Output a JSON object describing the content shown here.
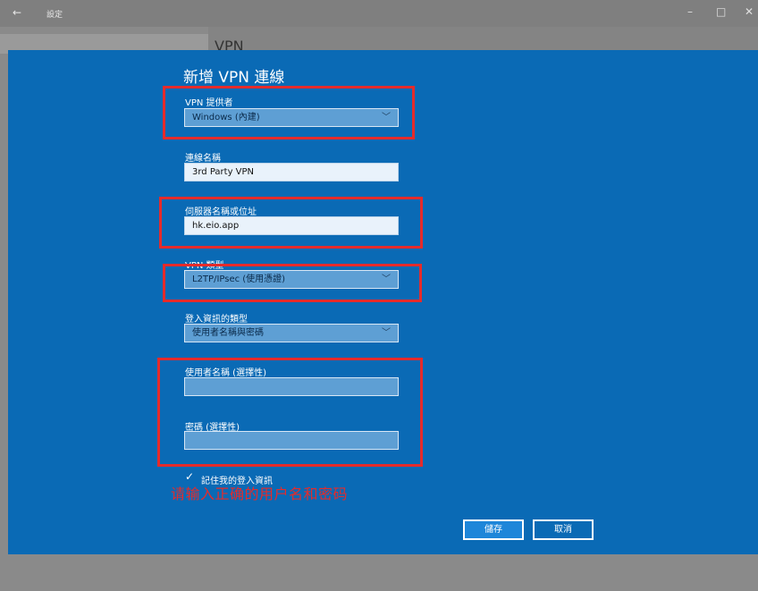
{
  "window": {
    "back_glyph": "←",
    "title": "設定",
    "minimize": "–",
    "maximize": "□",
    "close": "✕",
    "background_heading": "VPN"
  },
  "dialog": {
    "title": "新增 VPN 連線",
    "vpn_provider": {
      "label": "VPN 提供者",
      "value": "Windows (內建)"
    },
    "connection_name": {
      "label": "連線名稱",
      "value": "3rd Party VPN"
    },
    "server": {
      "label": "伺服器名稱或位址",
      "value": "hk.eio.app"
    },
    "vpn_type": {
      "label": "VPN 類型",
      "value": "L2TP/IPsec (使用憑證)"
    },
    "signin_type": {
      "label": "登入資訊的類型",
      "value": "使用者名稱與密碼"
    },
    "username": {
      "label": "使用者名稱 (選擇性)",
      "value": ""
    },
    "password": {
      "label": "密碼 (選擇性)",
      "value": ""
    },
    "remember": {
      "label": "記住我的登入資訊",
      "checked": true,
      "check_glyph": "✓"
    },
    "save_label": "儲存",
    "cancel_label": "取消"
  },
  "annotation": {
    "text": "请输入正确的用户名和密码",
    "color": "#e52b2b"
  },
  "colors": {
    "accent": "#0a6ab5",
    "highlight": "#e52b2b"
  }
}
